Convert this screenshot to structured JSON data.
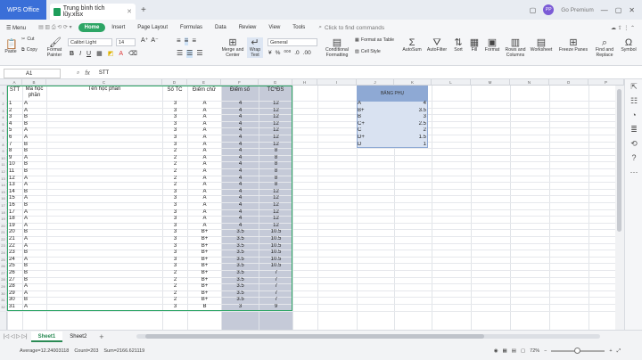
{
  "titlebar": {
    "app": "WPS Office",
    "doc_tab": "Trung bình tích lũy.xlsx",
    "avatar": "PP",
    "premium": "Go Premium"
  },
  "menu": {
    "hamburger": "Menu",
    "items": [
      "Home",
      "Insert",
      "Page Layout",
      "Formulas",
      "Data",
      "Review",
      "View",
      "Tools"
    ],
    "search_placeholder": "Click to find commands"
  },
  "ribbon": {
    "paste": "Paste",
    "cut": "Cut",
    "copy": "Copy",
    "format_painter": "Format\nPainter",
    "font_name": "Calibri Light",
    "font_size": "14",
    "merge_center": "Merge and\nCenter",
    "wrap_text": "Wrap\nText",
    "number_format": "General",
    "conditional_formatting": "Conditional\nFormatting",
    "format_as_table": "Format as Table",
    "cell_style": "Cell Style",
    "autosum": "AutoSum",
    "autofilter": "AutoFilter",
    "sort": "Sort",
    "fill": "Fill",
    "format": "Format",
    "rows_columns": "Rows and\nColumns",
    "worksheet": "Worksheet",
    "freeze_panes": "Freeze Panes",
    "find_replace": "Find and\nReplace",
    "symbol": "Symbol"
  },
  "formula_bar": {
    "name_box": "A1",
    "fx": "fx",
    "value": "STT"
  },
  "columns": [
    "A",
    "B",
    "C",
    "D",
    "E",
    "F",
    "G",
    "H",
    "I",
    "J",
    "K",
    "L",
    "M",
    "N",
    "O",
    "P",
    "Q"
  ],
  "table": {
    "headers": [
      "STT",
      "Mã học phần",
      "Tên học phần",
      "Số TC",
      "Điểm chữ",
      "Điểm số",
      "TC*ĐS"
    ],
    "rows": [
      [
        "1",
        "A",
        "",
        "3",
        "A",
        "4",
        "12"
      ],
      [
        "2",
        "A",
        "",
        "3",
        "A",
        "4",
        "12"
      ],
      [
        "3",
        "B",
        "",
        "3",
        "A",
        "4",
        "12"
      ],
      [
        "4",
        "B",
        "",
        "3",
        "A",
        "4",
        "12"
      ],
      [
        "5",
        "A",
        "",
        "3",
        "A",
        "4",
        "12"
      ],
      [
        "6",
        "A",
        "",
        "3",
        "A",
        "4",
        "12"
      ],
      [
        "7",
        "B",
        "",
        "3",
        "A",
        "4",
        "12"
      ],
      [
        "8",
        "B",
        "",
        "2",
        "A",
        "4",
        "8"
      ],
      [
        "9",
        "A",
        "",
        "2",
        "A",
        "4",
        "8"
      ],
      [
        "10",
        "B",
        "",
        "2",
        "A",
        "4",
        "8"
      ],
      [
        "11",
        "B",
        "",
        "2",
        "A",
        "4",
        "8"
      ],
      [
        "12",
        "A",
        "",
        "2",
        "A",
        "4",
        "8"
      ],
      [
        "13",
        "A",
        "",
        "2",
        "A",
        "4",
        "8"
      ],
      [
        "14",
        "B",
        "",
        "3",
        "A",
        "4",
        "12"
      ],
      [
        "15",
        "A",
        "",
        "3",
        "A",
        "4",
        "12"
      ],
      [
        "16",
        "B",
        "",
        "3",
        "A",
        "4",
        "12"
      ],
      [
        "17",
        "A",
        "",
        "3",
        "A",
        "4",
        "12"
      ],
      [
        "18",
        "A",
        "",
        "3",
        "A",
        "4",
        "12"
      ],
      [
        "19",
        "A",
        "",
        "3",
        "A",
        "4",
        "12"
      ],
      [
        "20",
        "B",
        "",
        "3",
        "B+",
        "3.5",
        "10.5"
      ],
      [
        "21",
        "A",
        "",
        "3",
        "B+",
        "3.5",
        "10.5"
      ],
      [
        "22",
        "A",
        "",
        "3",
        "B+",
        "3.5",
        "10.5"
      ],
      [
        "23",
        "B",
        "",
        "3",
        "B+",
        "3.5",
        "10.5"
      ],
      [
        "24",
        "A",
        "",
        "3",
        "B+",
        "3.5",
        "10.5"
      ],
      [
        "25",
        "B",
        "",
        "3",
        "B+",
        "3.5",
        "10.5"
      ],
      [
        "26",
        "B",
        "",
        "2",
        "B+",
        "3.5",
        "7"
      ],
      [
        "27",
        "B",
        "",
        "2",
        "B+",
        "3.5",
        "7"
      ],
      [
        "28",
        "A",
        "",
        "2",
        "B+",
        "3.5",
        "7"
      ],
      [
        "29",
        "A",
        "",
        "2",
        "B+",
        "3.5",
        "7"
      ],
      [
        "30",
        "B",
        "",
        "2",
        "B+",
        "3.5",
        "7"
      ],
      [
        "31",
        "A",
        "",
        "3",
        "B",
        "3",
        "9"
      ]
    ]
  },
  "lookup": {
    "title": "BẢNG PHỤ",
    "rows": [
      [
        "A",
        "4"
      ],
      [
        "B+",
        "3.5"
      ],
      [
        "B",
        "3"
      ],
      [
        "C+",
        "2.5"
      ],
      [
        "C",
        "2"
      ],
      [
        "D+",
        "1.5"
      ],
      [
        "D",
        "1"
      ]
    ]
  },
  "sheets": [
    "Sheet1",
    "Sheet2"
  ],
  "status": {
    "average": "Average=12.24003118",
    "count": "Count=203",
    "sum": "Sum=2166.621119",
    "zoom": "72%"
  },
  "colors": {
    "accent": "#2da565",
    "wps_blue": "#3a6fd8",
    "shade": "#c5cad8",
    "lookup_header": "#8ea9d4"
  }
}
